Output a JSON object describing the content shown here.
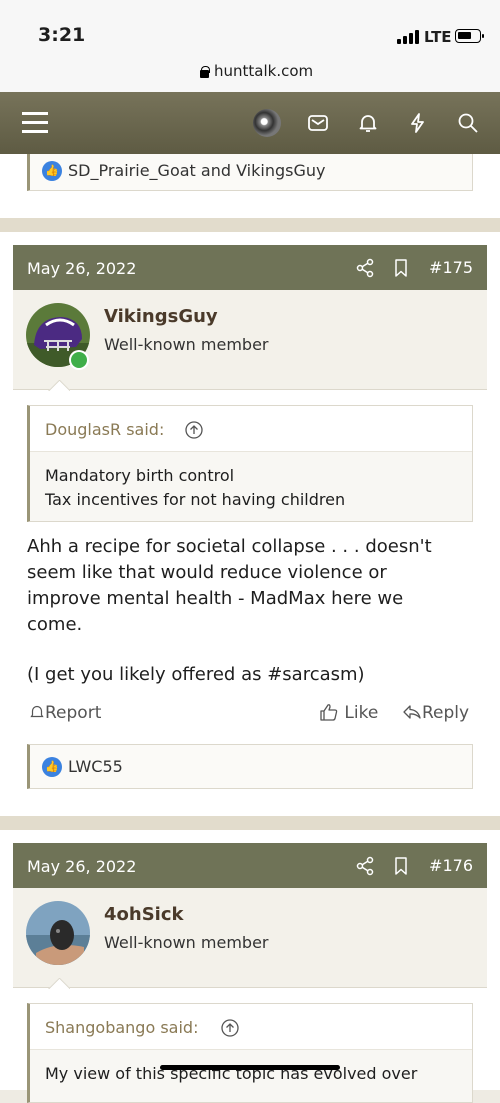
{
  "status_bar": {
    "time": "3:21",
    "network": "LTE"
  },
  "browser": {
    "url": "hunttalk.com"
  },
  "nav": {
    "icons": [
      "menu-icon",
      "avatar",
      "mail-icon",
      "bell-icon",
      "lightning-icon",
      "search-icon"
    ]
  },
  "prev_reactions": {
    "text": "SD_Prairie_Goat and VikingsGuy"
  },
  "posts": [
    {
      "date": "May 26, 2022",
      "number": "#175",
      "username": "VikingsGuy",
      "user_title": "Well-known member",
      "quote_author": "DouglasR said:",
      "quote_lines": [
        "Mandatory birth control",
        "Tax incentives for not having children"
      ],
      "message_lines": [
        "Ahh a recipe for societal collapse . . . doesn't",
        "seem like that would reduce violence or",
        "improve mental health - MadMax here we",
        "come.",
        "",
        "(I get you likely offered as #sarcasm)"
      ],
      "report_label": "Report",
      "like_label": "Like",
      "reply_label": "Reply",
      "reactions": "LWC55"
    },
    {
      "date": "May 26, 2022",
      "number": "#176",
      "username": "4ohSick",
      "user_title": "Well-known member",
      "quote_author": "Shangobango said:",
      "quote_lines": [
        "My view of this specific topic has evolved over"
      ]
    }
  ]
}
